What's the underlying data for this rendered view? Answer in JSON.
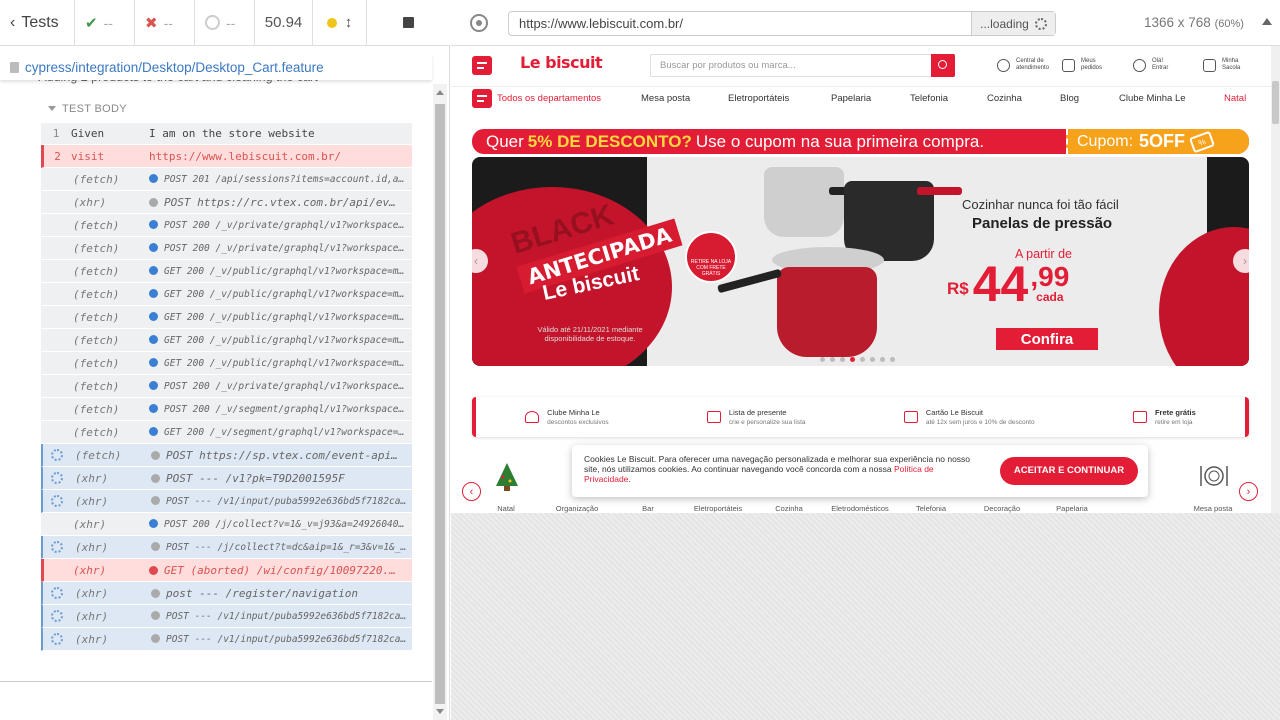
{
  "runner": {
    "tests_label": "Tests",
    "passed": "--",
    "failed": "--",
    "pending": "--",
    "duration": "50.94",
    "spec_path": "cypress/integration/Desktop/Desktop_Cart.feature",
    "scenario": "Adding 2 products to the cart and cleaning the cart",
    "test_body_label": "TEST BODY",
    "commands": [
      {
        "num": "1",
        "name": "Given",
        "msg": "I am on the store website",
        "state": "given",
        "dot": ""
      },
      {
        "num": "2",
        "name": "visit",
        "msg": "https://www.lebiscuit.com.br/",
        "state": "failed",
        "dot": ""
      },
      {
        "num": "",
        "name": "(fetch)",
        "msg": "POST 201 /api/sessions?items=account.id,a…",
        "state": "normal",
        "dot": "blue",
        "small": true
      },
      {
        "num": "",
        "name": "(xhr)",
        "msg": "POST https://rc.vtex.com.br/api/ev…",
        "state": "normal",
        "dot": "gray"
      },
      {
        "num": "",
        "name": "(fetch)",
        "msg": "POST 200 /_v/private/graphql/v1?workspace…",
        "state": "normal",
        "dot": "blue",
        "small": true
      },
      {
        "num": "",
        "name": "(fetch)",
        "msg": "POST 200 /_v/private/graphql/v1?workspace…",
        "state": "normal",
        "dot": "blue",
        "small": true
      },
      {
        "num": "",
        "name": "(fetch)",
        "msg": "GET 200 /_v/public/graphql/v1?workspace=m…",
        "state": "normal",
        "dot": "blue",
        "small": true
      },
      {
        "num": "",
        "name": "(fetch)",
        "msg": "GET 200 /_v/public/graphql/v1?workspace=m…",
        "state": "normal",
        "dot": "blue",
        "small": true
      },
      {
        "num": "",
        "name": "(fetch)",
        "msg": "GET 200 /_v/public/graphql/v1?workspace=m…",
        "state": "normal",
        "dot": "blue",
        "small": true
      },
      {
        "num": "",
        "name": "(fetch)",
        "msg": "GET 200 /_v/public/graphql/v1?workspace=m…",
        "state": "normal",
        "dot": "blue",
        "small": true
      },
      {
        "num": "",
        "name": "(fetch)",
        "msg": "GET 200 /_v/public/graphql/v1?workspace=m…",
        "state": "normal",
        "dot": "blue",
        "small": true
      },
      {
        "num": "",
        "name": "(fetch)",
        "msg": "POST 200 /_v/private/graphql/v1?workspace…",
        "state": "normal",
        "dot": "blue",
        "small": true
      },
      {
        "num": "",
        "name": "(fetch)",
        "msg": "POST 200 /_v/segment/graphql/v1?workspace=…",
        "state": "normal",
        "dot": "blue",
        "small": true
      },
      {
        "num": "",
        "name": "(fetch)",
        "msg": "GET 200 /_v/segment/graphql/v1?workspace=…",
        "state": "normal",
        "dot": "blue",
        "small": true
      },
      {
        "num": "",
        "name": "(fetch)",
        "msg": "POST https://sp.vtex.com/event-api…",
        "state": "pending",
        "dot": "gray"
      },
      {
        "num": "",
        "name": "(xhr)",
        "msg": "POST --- /v1?pk=T9D2001595F",
        "state": "pending",
        "dot": "gray"
      },
      {
        "num": "",
        "name": "(xhr)",
        "msg": "POST --- /v1/input/puba5992e636bd5f7182ca…",
        "state": "pending",
        "dot": "gray",
        "small": true
      },
      {
        "num": "",
        "name": "(xhr)",
        "msg": "POST 200 /j/collect?v=1&_v=j93&a=24926040…",
        "state": "normal",
        "dot": "blue",
        "small": true
      },
      {
        "num": "",
        "name": "(xhr)",
        "msg": "POST --- /j/collect?t=dc&aip=1&_r=3&v=1&_…",
        "state": "pending",
        "dot": "gray",
        "small": true
      },
      {
        "num": "",
        "name": "(xhr)",
        "msg": "GET (aborted) /wi/config/10097220.…",
        "state": "failed",
        "dot": "red"
      },
      {
        "num": "",
        "name": "(xhr)",
        "msg": "post --- /register/navigation",
        "state": "pending",
        "dot": "gray"
      },
      {
        "num": "",
        "name": "(xhr)",
        "msg": "POST --- /v1/input/puba5992e636bd5f7182ca…",
        "state": "pending",
        "dot": "gray",
        "small": true
      },
      {
        "num": "",
        "name": "(xhr)",
        "msg": "POST --- /v1/input/puba5992e636bd5f7182ca…",
        "state": "pending",
        "dot": "gray",
        "small": true
      }
    ]
  },
  "aut": {
    "url": "https://www.lebiscuit.com.br/",
    "loading": "...loading",
    "viewport": "1366 x 768",
    "scale": "(60%)"
  },
  "site": {
    "logo": "Le biscuit",
    "search_placeholder": "Buscar por produtos ou marca...",
    "header_items": [
      {
        "line1": "Central de",
        "line2": "atendimento"
      },
      {
        "line1": "Meus",
        "line2": "pedidos"
      },
      {
        "line1": "Olá!",
        "line2": "Entrar"
      },
      {
        "line1": "Minha",
        "line2": "Sacola"
      }
    ],
    "nav": [
      "Todos os departamentos",
      "Mesa posta",
      "Eletroportáteis",
      "Papelaria",
      "Telefonia",
      "Cozinha",
      "Blog",
      "Clube Minha Le",
      "Natal"
    ],
    "promo": {
      "pre": "Quer",
      "highlight": "5% DE DESCONTO?",
      "post": "Use o cupom na sua primeira compra.",
      "cupom_label": "Cupom:",
      "cupom_code": "5OFF",
      "tag": "%"
    },
    "banner": {
      "black": "BLACK",
      "antecipada": "ANTECIPADA",
      "brand": "Le biscuit",
      "stamp": "RETIRE NA LOJA COM FRETE GRÁTIS",
      "valid": "Válido até 21/11/2021 mediante disponibilidade de estoque.",
      "head1": "Cozinhar nunca foi tão fácil",
      "head2": "Panelas de pressão",
      "from": "A partir de",
      "currency": "R$",
      "price_int": "44",
      "price_dec": ",99",
      "unit": "cada",
      "cta": "Confira"
    },
    "benefits": [
      {
        "title": "Clube Minha Le",
        "sub": "descontos exclusivos"
      },
      {
        "title": "Lista de presente",
        "sub": "crie e personalize sua lista"
      },
      {
        "title": "Cartão Le Biscuit",
        "sub": "até 12x sem juros e 10% de desconto"
      },
      {
        "title": "Frete grátis",
        "sub": "retire em loja"
      }
    ],
    "categories": [
      "Natal",
      "Organização",
      "Bar",
      "Eletroportáteis",
      "Cozinha",
      "Eletrodomésticos",
      "Telefonia",
      "Decoração",
      "Papelaria",
      "Mesa posta"
    ],
    "cookie": {
      "text": "Cookies Le Biscuit. Para oferecer uma navegação personalizada e melhorar sua experiência no nosso site, nós utilizamos cookies. Ao continuar navegando você concorda com a nossa",
      "link": "Política de Privacidade",
      "end": ".",
      "accept": "ACEITAR E CONTINUAR"
    }
  }
}
